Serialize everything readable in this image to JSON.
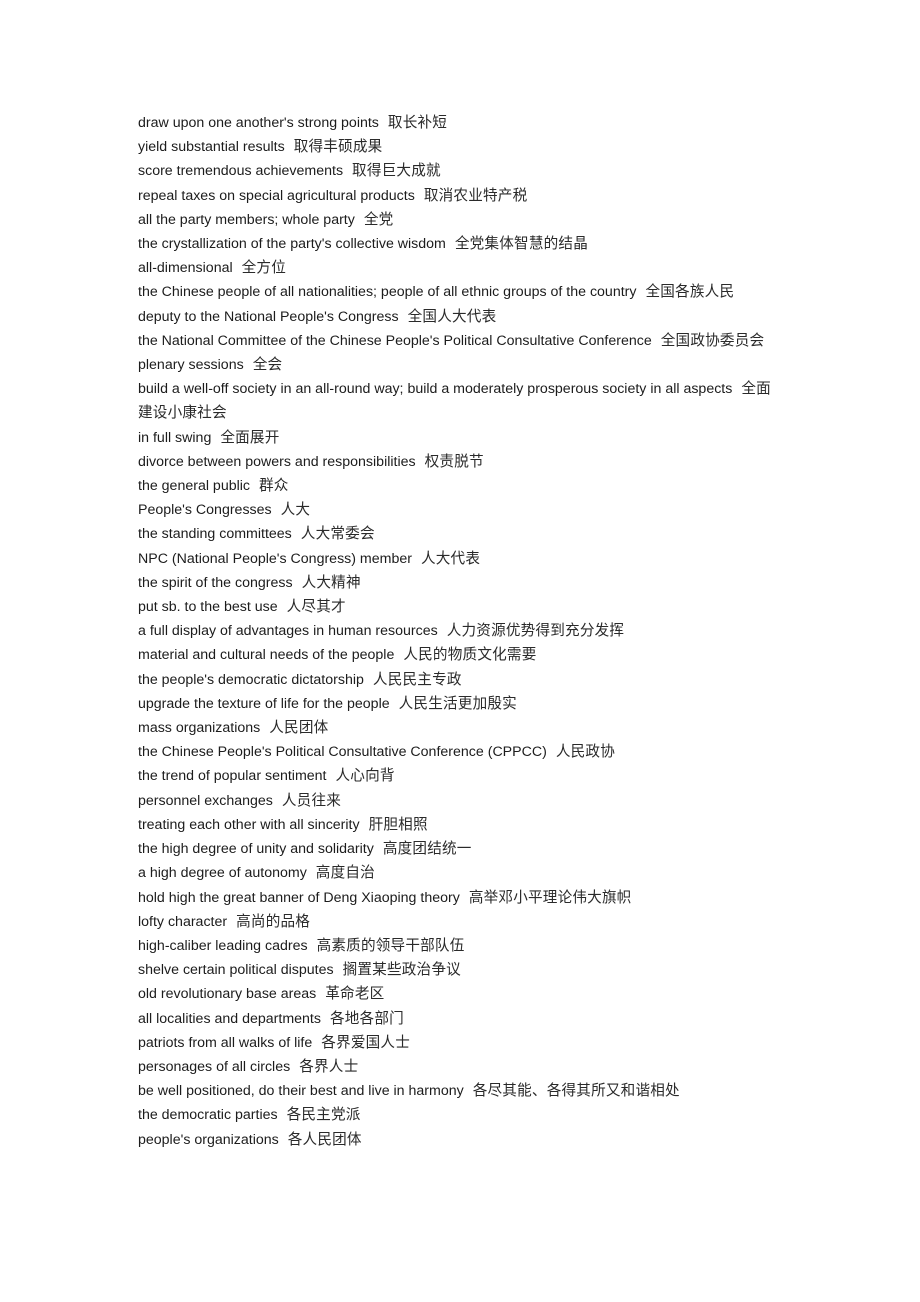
{
  "document": {
    "type": "bilingual-glossary",
    "language_pair": "English-Chinese",
    "entries": [
      {
        "en": "draw upon one another's strong points",
        "zh": "取长补短"
      },
      {
        "en": "yield substantial results",
        "zh": "取得丰硕成果"
      },
      {
        "en": "score tremendous achievements",
        "zh": "取得巨大成就"
      },
      {
        "en": "repeal taxes on special agricultural products",
        "zh": "取消农业特产税"
      },
      {
        "en": "all the party members; whole party",
        "zh": "全党"
      },
      {
        "en": "the crystallization of the party's collective wisdom",
        "zh": "全党集体智慧的结晶"
      },
      {
        "en": "all-dimensional",
        "zh": "全方位"
      },
      {
        "en": "the Chinese people of all nationalities; people of all ethnic groups of the country",
        "zh": "全国各族人民"
      },
      {
        "en": "deputy to the National People's Congress",
        "zh": "全国人大代表"
      },
      {
        "en": "the National Committee of the Chinese People's Political Consultative Conference",
        "zh": "全国政协委员会"
      },
      {
        "en": "plenary sessions",
        "zh": "全会"
      },
      {
        "en": "build a well-off society in an all-round way; build a moderately prosperous society in all aspects",
        "zh": "全面建设小康社会"
      },
      {
        "en": "in full swing",
        "zh": "全面展开"
      },
      {
        "en": "divorce between powers and responsibilities",
        "zh": "权责脱节"
      },
      {
        "en": "the general public",
        "zh": "群众"
      },
      {
        "en": "People's Congresses",
        "zh": "人大"
      },
      {
        "en": "the standing committees",
        "zh": "人大常委会"
      },
      {
        "en": "NPC (National People's Congress) member",
        "zh": "人大代表"
      },
      {
        "en": "the spirit of the congress",
        "zh": "人大精神"
      },
      {
        "en": "put sb. to the best use",
        "zh": "人尽其才"
      },
      {
        "en": "a full display of advantages in human resources",
        "zh": "人力资源优势得到充分发挥"
      },
      {
        "en": "material and cultural needs of the people",
        "zh": "人民的物质文化需要"
      },
      {
        "en": "the people's democratic dictatorship",
        "zh": "人民民主专政"
      },
      {
        "en": "upgrade the texture of life for the people",
        "zh": "人民生活更加殷实"
      },
      {
        "en": "mass organizations",
        "zh": "人民团体"
      },
      {
        "en": "the Chinese People's Political Consultative Conference (CPPCC)",
        "zh": "人民政协"
      },
      {
        "en": "the trend of popular sentiment",
        "zh": "人心向背"
      },
      {
        "en": "personnel exchanges",
        "zh": "人员往来"
      },
      {
        "en": "treating each other with all sincerity",
        "zh": "肝胆相照"
      },
      {
        "en": "the high degree of unity and solidarity",
        "zh": "高度团结统一"
      },
      {
        "en": "a high degree of autonomy",
        "zh": "高度自治"
      },
      {
        "en": "hold high the great banner of Deng Xiaoping theory",
        "zh": "高举邓小平理论伟大旗帜"
      },
      {
        "en": "lofty character",
        "zh": "高尚的品格"
      },
      {
        "en": "high-caliber leading cadres",
        "zh": "高素质的领导干部队伍"
      },
      {
        "en": "shelve certain political disputes",
        "zh": "搁置某些政治争议"
      },
      {
        "en": "old revolutionary base areas",
        "zh": "革命老区"
      },
      {
        "en": "all localities and departments",
        "zh": "各地各部门"
      },
      {
        "en": "patriots from all walks of life",
        "zh": "各界爱国人士"
      },
      {
        "en": "personages of all circles",
        "zh": "各界人士"
      },
      {
        "en": "be well positioned, do their best and live in harmony",
        "zh": "各尽其能、各得其所又和谐相处"
      },
      {
        "en": "the democratic parties",
        "zh": "各民主党派"
      },
      {
        "en": "people's organizations",
        "zh": "各人民团体"
      }
    ]
  }
}
